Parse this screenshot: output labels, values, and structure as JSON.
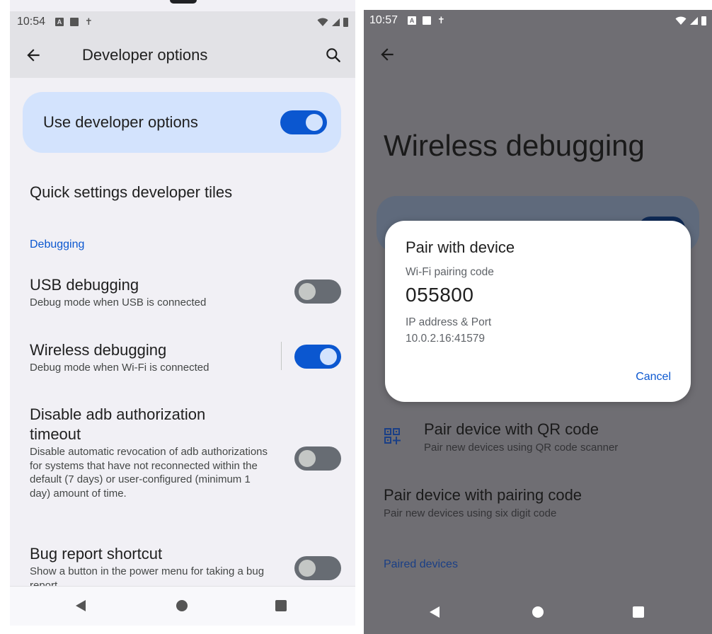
{
  "left_screen": {
    "status_bar": {
      "time": "10:54",
      "notification_letter": "A"
    },
    "app_bar": {
      "title": "Developer options"
    },
    "master_switch": {
      "label": "Use developer options",
      "on": true
    },
    "quick_settings": {
      "title": "Quick settings developer tiles"
    },
    "section_debugging": "Debugging",
    "settings": [
      {
        "title": "USB debugging",
        "summary": "Debug mode when USB is connected",
        "on": false
      },
      {
        "title": "Wireless debugging",
        "summary": "Debug mode when Wi-Fi is connected",
        "on": true
      },
      {
        "title": "Disable adb authorization timeout",
        "summary": "Disable automatic revocation of adb authorizations for systems that have not reconnected within the default (7 days) or user-configured (minimum 1 day) amount of time.",
        "on": false
      },
      {
        "title": "Bug report shortcut",
        "summary": "Show a button in the power menu for taking a bug report",
        "on": false
      }
    ]
  },
  "right_screen": {
    "status_bar": {
      "time": "10:57",
      "notification_letter": "A"
    },
    "title": "Wireless debugging",
    "items": [
      {
        "title": "Pair device with QR code",
        "summary": "Pair new devices using QR code scanner"
      },
      {
        "title": "Pair device with pairing code",
        "summary": "Pair new devices using six digit code"
      }
    ],
    "section_paired": "Paired devices",
    "dialog": {
      "title": "Pair with device",
      "code_label": "Wi-Fi pairing code",
      "code": "055800",
      "ip_label": "IP address & Port",
      "ip_value": "10.0.2.16:41579",
      "cancel_label": "Cancel"
    }
  },
  "icons": {
    "back": "arrow-back-icon",
    "search": "search-icon",
    "qr": "qr-code-add-icon",
    "wifi": "wifi-icon",
    "signal": "signal-icon",
    "battery": "battery-icon"
  },
  "colors": {
    "accent": "#0b57d0",
    "master_switch_bg": "#d3e3fd",
    "screen_bg": "#f1f0f5",
    "scrim": "#6f6e73"
  }
}
